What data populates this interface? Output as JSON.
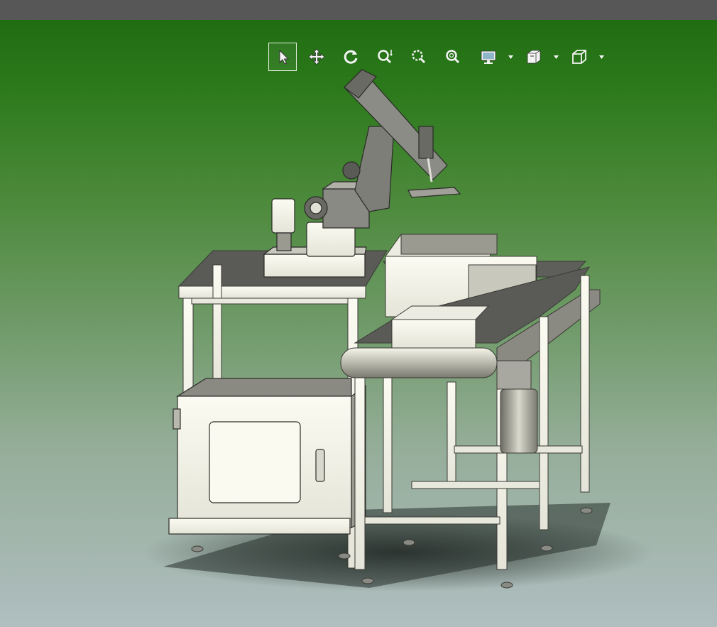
{
  "window": {
    "title": ""
  },
  "toolbar": {
    "buttons": [
      {
        "id": "select",
        "icon": "select-arrow-icon",
        "active": true
      },
      {
        "id": "pan",
        "icon": "pan-move-icon",
        "active": false
      },
      {
        "id": "rotate",
        "icon": "rotate-icon",
        "active": false
      },
      {
        "id": "zoom-in-out",
        "icon": "zoom-in-out-icon",
        "active": false
      },
      {
        "id": "zoom-area",
        "icon": "zoom-area-icon",
        "active": false
      },
      {
        "id": "zoom-fit",
        "icon": "zoom-fit-icon",
        "active": false
      },
      {
        "id": "display",
        "icon": "display-monitor-icon",
        "active": false,
        "dropdown": true
      },
      {
        "id": "section",
        "icon": "section-view-icon",
        "active": false,
        "dropdown": true
      },
      {
        "id": "view-orientation",
        "icon": "view-cube-icon",
        "active": false,
        "dropdown": true
      }
    ]
  },
  "viewport": {
    "background_top": "#206e12",
    "background_bottom": "#b0bec0",
    "model": "robot-arm-workcell-assembly"
  }
}
